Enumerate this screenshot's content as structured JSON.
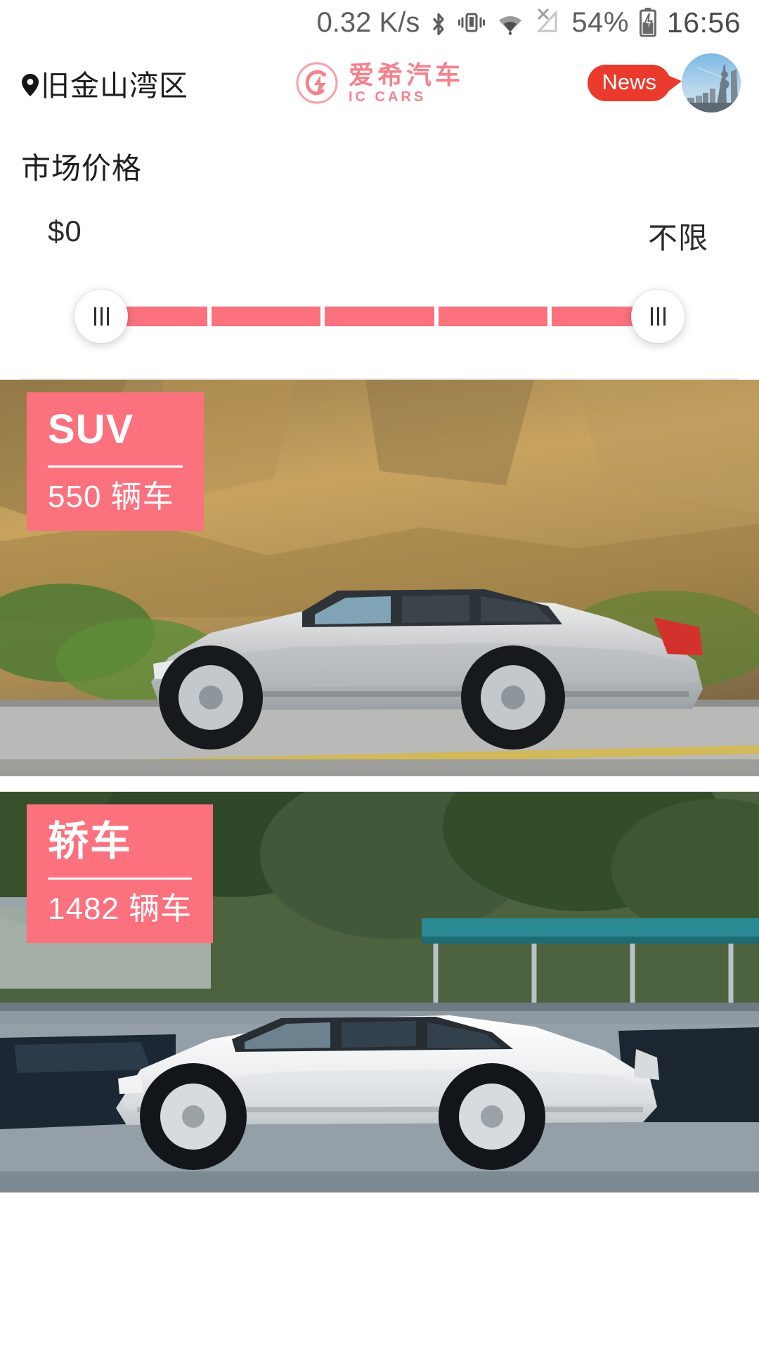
{
  "statusbar": {
    "network_speed": "0.32 K/s",
    "bluetooth_icon": "bluetooth-icon",
    "vibrate_icon": "vibrate-icon",
    "wifi_icon": "wifi-icon",
    "signal_icon": "signal-no-service-icon",
    "battery_percent": "54%",
    "battery_icon": "battery-charging-icon",
    "time": "16:56"
  },
  "header": {
    "location_icon": "location-pin-icon",
    "location": "旧金山湾区",
    "brand_cn": "爱希汽车",
    "brand_en": "IC CARS",
    "brand_logo_icon": "ic-cars-logo-icon",
    "news_label": "News",
    "avatar_icon": "user-avatar-skyline"
  },
  "filter": {
    "title": "市场价格",
    "min_label": "$0",
    "max_label": "不限",
    "segments": 5,
    "left_knob_icon": "slider-handle-grip",
    "right_knob_icon": "slider-handle-grip"
  },
  "cards": [
    {
      "name": "suv",
      "title": "SUV",
      "count": "550 辆车",
      "photo": "silver-suv-parked-by-rock-cliff"
    },
    {
      "name": "sedan",
      "title": "轿车",
      "count": "1482 辆车",
      "photo": "white-sedan-parked-under-trees"
    }
  ],
  "colors": {
    "accent_pink": "#fb717e",
    "brand_pink": "#f4828c",
    "news_red": "#ea3a2d",
    "text_dark": "#1d1d1d"
  }
}
